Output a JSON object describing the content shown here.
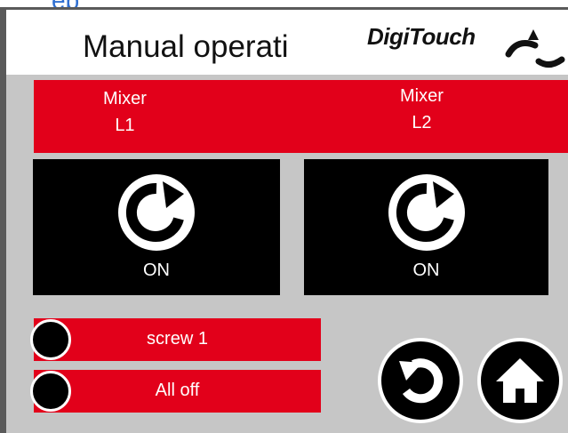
{
  "header": {
    "partial_top_text": "ep",
    "title": "Manual operati",
    "logo_text": "DigiTouch"
  },
  "mixers": [
    {
      "label_line1": "Mixer",
      "label_line2": "L1",
      "status": "ON",
      "icon": "rotate-icon"
    },
    {
      "label_line1": "Mixer",
      "label_line2": "L2",
      "status": "ON",
      "icon": "rotate-icon"
    }
  ],
  "buttons": {
    "screw_label": "screw 1",
    "all_off_label": "All off",
    "back_icon": "back-arrow-icon",
    "home_icon": "home-icon"
  },
  "colors": {
    "accent_red": "#e2001a",
    "panel_gray": "#c6c6c6",
    "tile_black": "#000000"
  }
}
